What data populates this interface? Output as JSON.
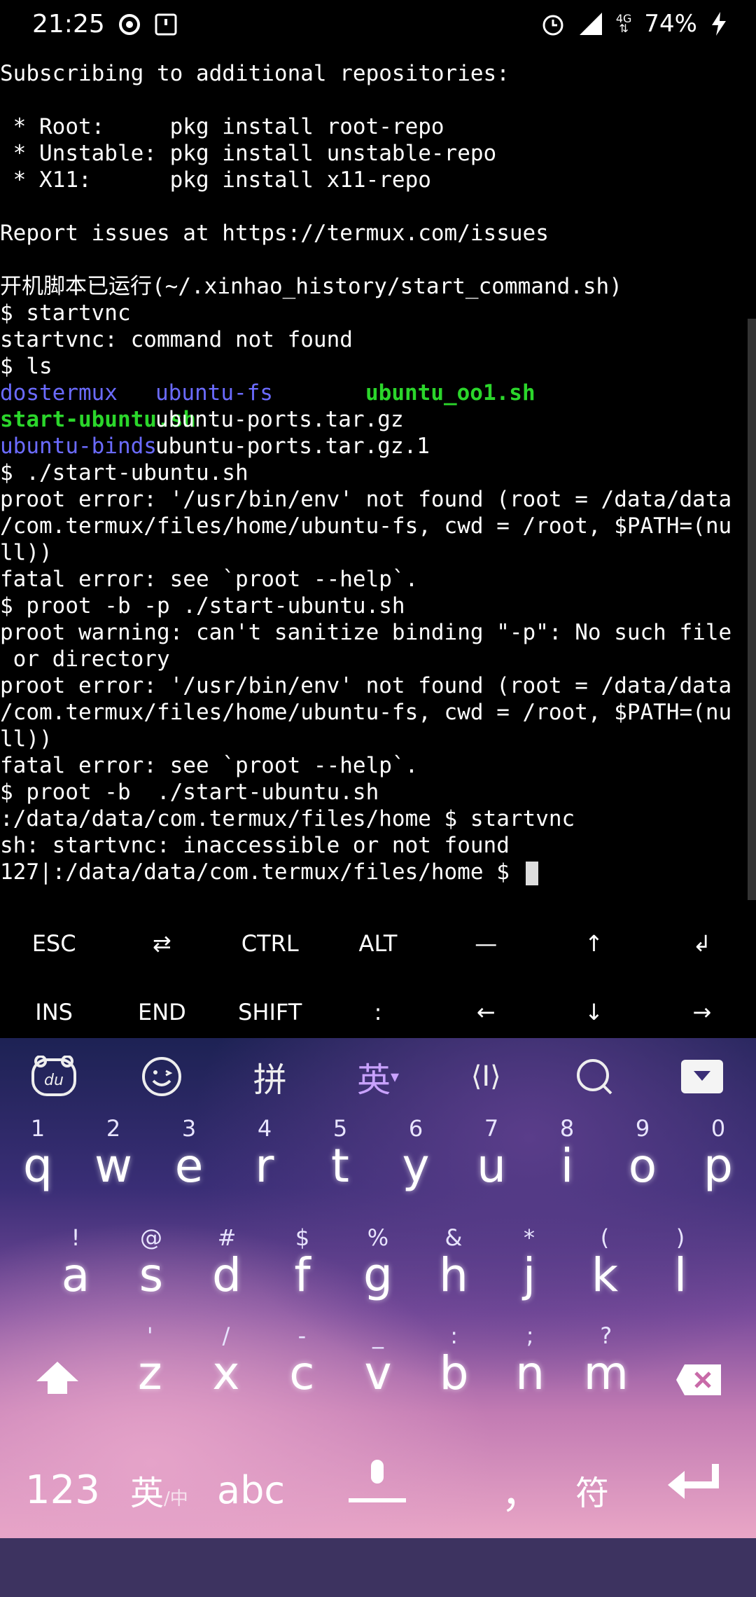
{
  "status_bar": {
    "time": "21:25",
    "network": "4G",
    "battery": "74%",
    "icons": [
      "hotspot-icon",
      "notification-box-icon",
      "alarm-icon",
      "signal-icon",
      "data-arrows-icon",
      "battery-charging-icon"
    ]
  },
  "terminal": {
    "lines": [
      {
        "text": "Subscribing to additional repositories:"
      },
      {
        "text": ""
      },
      {
        "text": " * Root:     pkg install root-repo"
      },
      {
        "text": " * Unstable: pkg install unstable-repo"
      },
      {
        "text": " * X11:      pkg install x11-repo"
      },
      {
        "text": ""
      },
      {
        "text": "Report issues at https://termux.com/issues"
      },
      {
        "text": ""
      },
      {
        "text": "开机脚本已运行(~/.xinhao_history/start_command.sh)"
      },
      {
        "text": "$ startvnc"
      },
      {
        "text": "startvnc: command not found"
      },
      {
        "text": "$ ls"
      },
      {
        "ls_row": [
          "dostermux",
          "ubuntu-fs",
          "ubuntu_oo1.sh"
        ]
      },
      {
        "ls_row": [
          "start-ubuntu.sh",
          "ubuntu-ports.tar.gz",
          ""
        ]
      },
      {
        "ls_row": [
          "ubuntu-binds",
          "ubuntu-ports.tar.gz.1",
          ""
        ]
      },
      {
        "text": "$ ./start-ubuntu.sh"
      },
      {
        "text": "proot error: '/usr/bin/env' not found (root = /data/data"
      },
      {
        "text": "/com.termux/files/home/ubuntu-fs, cwd = /root, $PATH=(nu"
      },
      {
        "text": "ll))"
      },
      {
        "text": "fatal error: see `proot --help`."
      },
      {
        "text": "$ proot -b -p ./start-ubuntu.sh"
      },
      {
        "text": "proot warning: can't sanitize binding \"-p\": No such file"
      },
      {
        "text": " or directory"
      },
      {
        "text": "proot error: '/usr/bin/env' not found (root = /data/data"
      },
      {
        "text": "/com.termux/files/home/ubuntu-fs, cwd = /root, $PATH=(nu"
      },
      {
        "text": "ll))"
      },
      {
        "text": "fatal error: see `proot --help`."
      },
      {
        "text": "$ proot -b  ./start-ubuntu.sh"
      },
      {
        "text": ":/data/data/com.termux/files/home $ startvnc"
      },
      {
        "text": "sh: startvnc: inaccessible or not found"
      },
      {
        "text": "127|:/data/data/com.termux/files/home $ "
      }
    ]
  },
  "extra_keys": {
    "row1": [
      "ESC",
      "⇄",
      "CTRL",
      "ALT",
      "—",
      "↑",
      "↲"
    ],
    "row2": [
      "INS",
      "END",
      "SHIFT",
      ":",
      "←",
      "↓",
      "→"
    ]
  },
  "keyboard": {
    "toolbar": {
      "pinyin": "拼",
      "english": "英",
      "english_arrow": "▾",
      "cursor": "⟨I⟩"
    },
    "row1": [
      {
        "hint": "1",
        "key": "q"
      },
      {
        "hint": "2",
        "key": "w"
      },
      {
        "hint": "3",
        "key": "e"
      },
      {
        "hint": "4",
        "key": "r"
      },
      {
        "hint": "5",
        "key": "t"
      },
      {
        "hint": "6",
        "key": "y"
      },
      {
        "hint": "7",
        "key": "u"
      },
      {
        "hint": "8",
        "key": "i"
      },
      {
        "hint": "9",
        "key": "o"
      },
      {
        "hint": "0",
        "key": "p"
      }
    ],
    "row2": [
      {
        "hint": "!",
        "key": "a"
      },
      {
        "hint": "@",
        "key": "s"
      },
      {
        "hint": "#",
        "key": "d"
      },
      {
        "hint": "$",
        "key": "f"
      },
      {
        "hint": "%",
        "key": "g"
      },
      {
        "hint": "&",
        "key": "h"
      },
      {
        "hint": "*",
        "key": "j"
      },
      {
        "hint": "(",
        "key": "k"
      },
      {
        "hint": ")",
        "key": "l"
      }
    ],
    "row3": [
      {
        "hint": "'",
        "key": "z"
      },
      {
        "hint": "/",
        "key": "x"
      },
      {
        "hint": "-",
        "key": "c"
      },
      {
        "hint": "_",
        "key": "v"
      },
      {
        "hint": ":",
        "key": "b"
      },
      {
        "hint": ";",
        "key": "n"
      },
      {
        "hint": "?",
        "key": "m"
      }
    ],
    "bottom": {
      "num": "123",
      "lang": "英",
      "lang_sub": "/中",
      "abc": "abc",
      "comma": "，",
      "symbols": "符"
    }
  }
}
